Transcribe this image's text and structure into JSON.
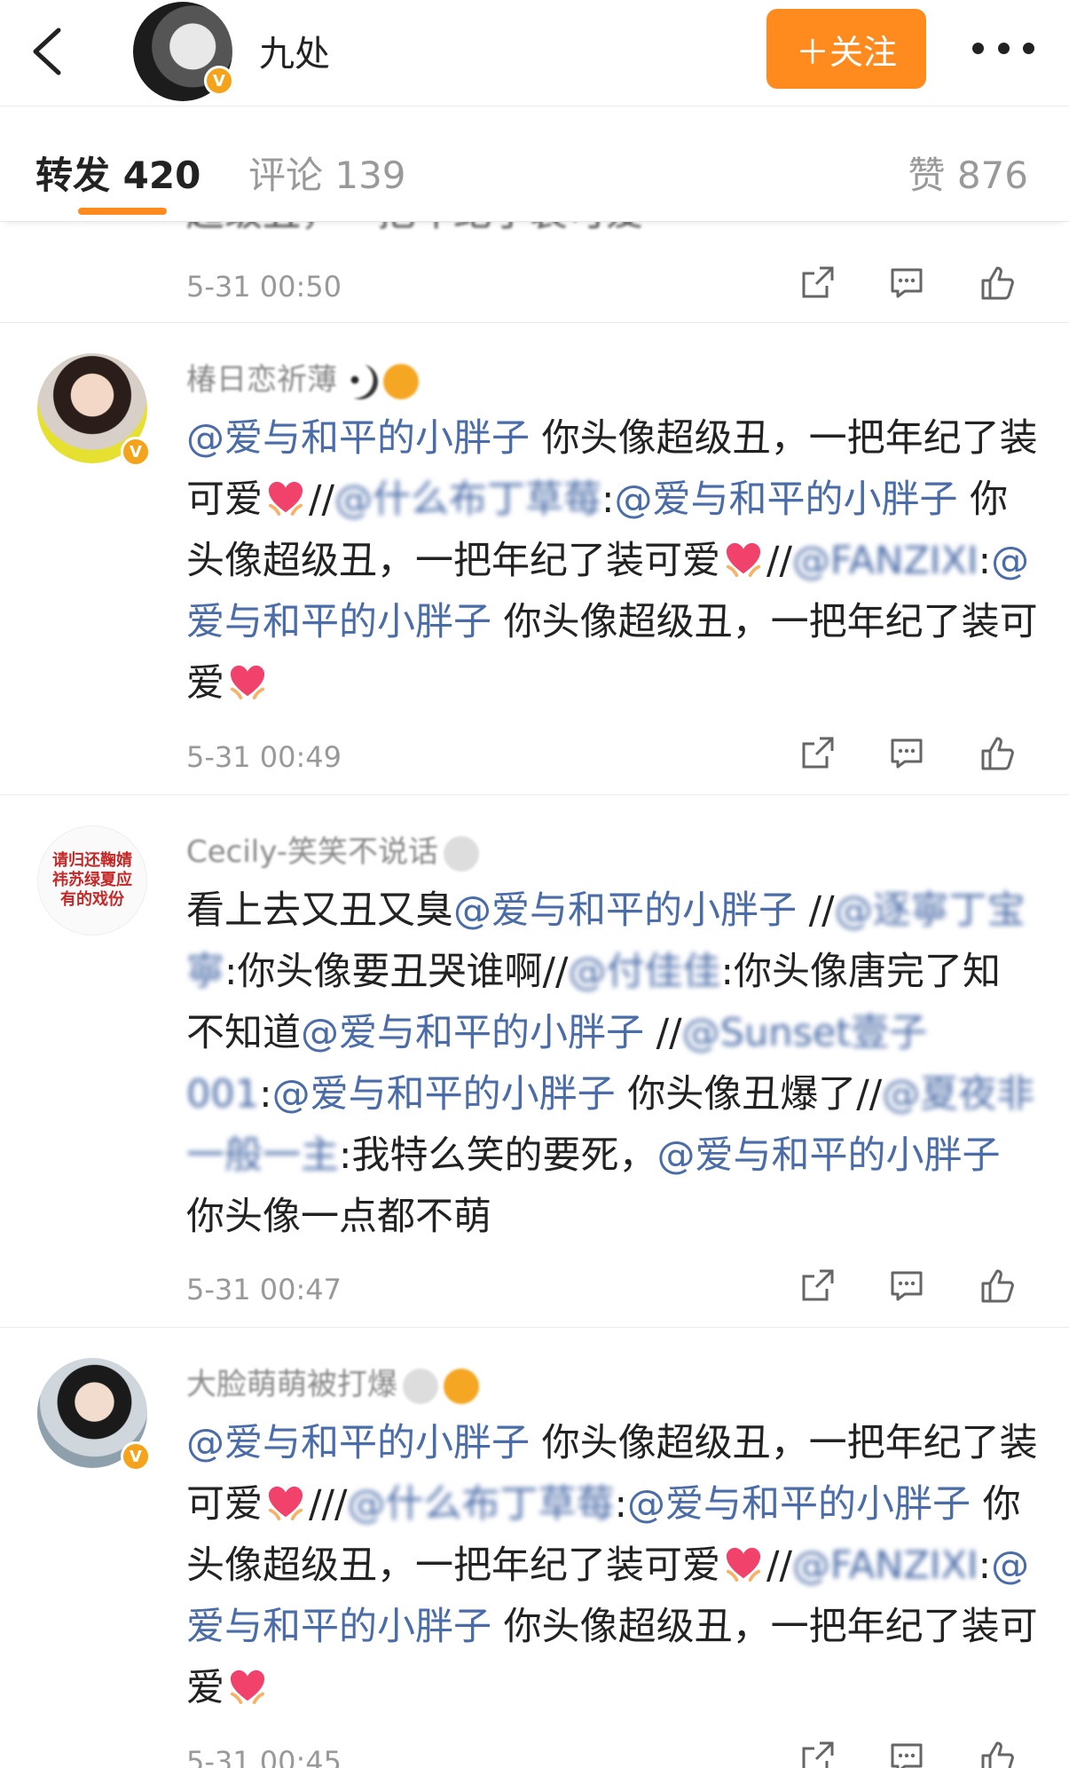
{
  "header": {
    "title": "九处",
    "verified_mark": "V",
    "follow_label": "＋关注"
  },
  "tabs": {
    "repost": "转发 420",
    "comment": "评论 139",
    "like": "赞 876"
  },
  "feed": [
    {
      "partial": true,
      "text_fragment": "超级丑，一把年纪了装可爱",
      "time": "5-31 00:50"
    },
    {
      "username": "椿日恋祈薄",
      "time": "5-31 00:49",
      "segments": [
        [
          "m",
          "@爱与和平的小胖子"
        ],
        [
          "t",
          " 你头像超级丑，一把年纪了装可爱"
        ],
        [
          "h",
          ""
        ],
        [
          "t",
          "//"
        ],
        [
          "b",
          "@什么布丁草莓"
        ],
        [
          "t",
          ":"
        ],
        [
          "m",
          "@爱与和平的小胖子"
        ],
        [
          "t",
          " 你头像超级丑，一把年纪了装可爱"
        ],
        [
          "h",
          ""
        ],
        [
          "t",
          "//"
        ],
        [
          "b",
          "@FANZIXI"
        ],
        [
          "t",
          ":"
        ],
        [
          "m",
          "@爱与和平的小胖子"
        ],
        [
          "t",
          " 你头像超级丑，一把年纪了装可爱"
        ],
        [
          "h",
          ""
        ]
      ]
    },
    {
      "username": "Cecily-笑笑不说话",
      "avatar_text": "请归还鞠婧祎苏绿夏应有的戏份",
      "time": "5-31 00:47",
      "segments": [
        [
          "t",
          "看上去又丑又臭"
        ],
        [
          "m",
          "@爱与和平的小胖子"
        ],
        [
          "t",
          " //"
        ],
        [
          "b",
          "@逐寧丁宝寧"
        ],
        [
          "t",
          ":你头像要丑哭谁啊//"
        ],
        [
          "b",
          "@付佳佳"
        ],
        [
          "t",
          ":你头像唐完了知不知道"
        ],
        [
          "m",
          "@爱与和平的小胖子"
        ],
        [
          "t",
          " //"
        ],
        [
          "b",
          "@Sunset壹子001"
        ],
        [
          "t",
          ":"
        ],
        [
          "m",
          "@爱与和平的小胖子"
        ],
        [
          "t",
          " 你头像丑爆了//"
        ],
        [
          "b",
          "@夏夜非一般一主"
        ],
        [
          "t",
          ":我特么笑的要死，"
        ],
        [
          "m",
          "@爱与和平的小胖子"
        ],
        [
          "t",
          " 你头像一点都不萌"
        ]
      ]
    },
    {
      "username": "大脸萌萌被打爆",
      "time": "5-31 00:45",
      "segments": [
        [
          "m",
          "@爱与和平的小胖子"
        ],
        [
          "t",
          " 你头像超级丑，一把年纪了装可爱"
        ],
        [
          "h",
          ""
        ],
        [
          "t",
          "///"
        ],
        [
          "b",
          "@什么布丁草莓"
        ],
        [
          "t",
          ":"
        ],
        [
          "m",
          "@爱与和平的小胖子"
        ],
        [
          "t",
          " 你头像超级丑，一把年纪了装可爱"
        ],
        [
          "h",
          ""
        ],
        [
          "t",
          "//"
        ],
        [
          "b",
          "@FANZIXI"
        ],
        [
          "t",
          ":"
        ],
        [
          "m",
          "@爱与和平的小胖子"
        ],
        [
          "t",
          " 你头像超级丑，一把年纪了装可爱"
        ],
        [
          "h",
          ""
        ]
      ]
    }
  ],
  "icons": {
    "back": "chevron-left-icon",
    "more": "more-dots-icon",
    "repost": "share-icon",
    "comment": "comment-icon",
    "like": "thumbs-up-icon",
    "heart": "heart-emoji-icon"
  },
  "colors": {
    "accent": "#ff8a1e",
    "mention": "#4a6ca8",
    "verified": "#f6a31c"
  }
}
